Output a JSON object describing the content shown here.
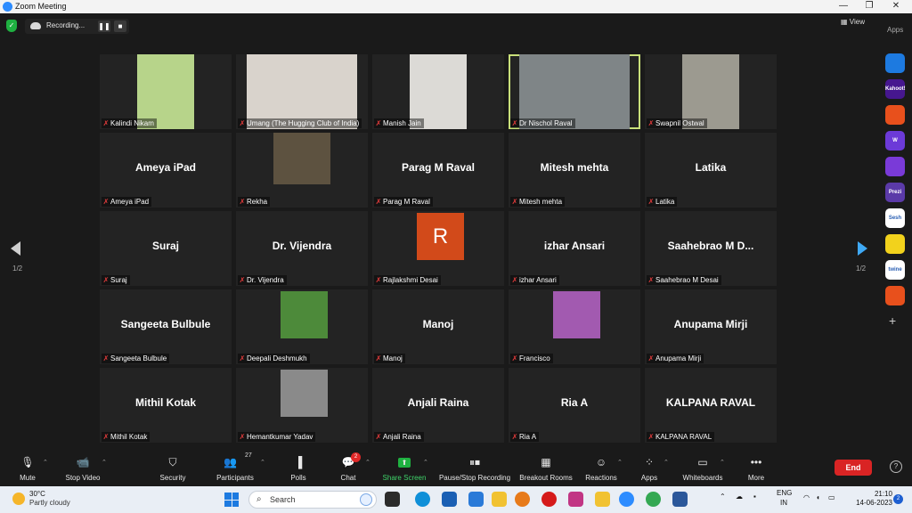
{
  "window": {
    "title": "Zoom Meeting",
    "minimize": "—",
    "restore": "❐",
    "close": "✕"
  },
  "top": {
    "recording_text": "Recording...",
    "pause_icon": "❚❚",
    "stop_icon": "■",
    "view_label": "View",
    "apps_label": "Apps"
  },
  "pagination": {
    "left": "1/2",
    "right": "1/2"
  },
  "participants": [
    {
      "label": "Kalindi Nikam",
      "display": "",
      "kind": "video",
      "video_color": "#b7d48a"
    },
    {
      "label": "Umang (The Hugging Club of India)",
      "display": "",
      "kind": "video",
      "video_color": "#d9d3cc"
    },
    {
      "label": "Manish Jain",
      "display": "",
      "kind": "video",
      "video_color": "#dcdad6"
    },
    {
      "label": "Dr Nischol Raval",
      "display": "",
      "kind": "video",
      "video_color": "#7f8587"
    },
    {
      "label": "Swapnil Ostwal",
      "display": "",
      "kind": "video",
      "video_color": "#9c9a90"
    },
    {
      "label": "Ameya iPad",
      "display": "Ameya iPad",
      "kind": "name"
    },
    {
      "label": "Rekha",
      "display": "",
      "kind": "video",
      "video_color": "#5d5240"
    },
    {
      "label": "Parag M Raval",
      "display": "Parag M Raval",
      "kind": "name"
    },
    {
      "label": "Mitesh mehta",
      "display": "Mitesh mehta",
      "kind": "name"
    },
    {
      "label": "Latika",
      "display": "Latika",
      "kind": "name"
    },
    {
      "label": "Suraj",
      "display": "Suraj",
      "kind": "name"
    },
    {
      "label": "Dr. Vijendra",
      "display": "Dr. Vijendra",
      "kind": "name"
    },
    {
      "label": "Rajlakshmi Desai",
      "display": "R",
      "kind": "initial",
      "avatar_color": "#d24a1a"
    },
    {
      "label": "izhar Ansari",
      "display": "izhar Ansari",
      "kind": "name"
    },
    {
      "label": "Saahebrao M Desai",
      "display": "Saahebrao M D...",
      "kind": "name"
    },
    {
      "label": "Sangeeta Bulbule",
      "display": "Sangeeta Bulbule",
      "kind": "name"
    },
    {
      "label": "Deepali Deshmukh",
      "display": "",
      "kind": "photo",
      "avatar_color": "#4d8a3a"
    },
    {
      "label": "Manoj",
      "display": "Manoj",
      "kind": "name"
    },
    {
      "label": "Francisco",
      "display": "",
      "kind": "photo",
      "avatar_color": "#a25ab0"
    },
    {
      "label": "Anupama Mirji",
      "display": "Anupama Mirji",
      "kind": "name"
    },
    {
      "label": "Mithil Kotak",
      "display": "Mithil Kotak",
      "kind": "name"
    },
    {
      "label": "Hemantkumar Yadav",
      "display": "",
      "kind": "photo",
      "avatar_color": "#8a8a8a"
    },
    {
      "label": "Anjali Raina",
      "display": "Anjali Raina",
      "kind": "name"
    },
    {
      "label": "Ria A",
      "display": "Ria A",
      "kind": "name"
    },
    {
      "label": "KALPANA RAVAL",
      "display": "KALPANA RAVAL",
      "kind": "name"
    }
  ],
  "app_rail": [
    {
      "name": "app-1",
      "text": "",
      "color": "#1d7ae0"
    },
    {
      "name": "kahoot",
      "text": "Kahoot!",
      "color": "#46178f"
    },
    {
      "name": "app-3",
      "text": "",
      "color": "#e8501c"
    },
    {
      "name": "wooclap",
      "text": "W",
      "color": "#6c3ad8"
    },
    {
      "name": "app-5",
      "text": "",
      "color": "#7a3ad8"
    },
    {
      "name": "prezi",
      "text": "Prezi",
      "color": "#5b3aa8"
    },
    {
      "name": "sesh",
      "text": "Sesh",
      "color": "#ffffff"
    },
    {
      "name": "app-8",
      "text": "",
      "color": "#f2d21c"
    },
    {
      "name": "twine",
      "text": "twine",
      "color": "#ffffff"
    },
    {
      "name": "app-10",
      "text": "",
      "color": "#e8501c"
    }
  ],
  "toolbar": {
    "mute": "Mute",
    "stop_video": "Stop Video",
    "security": "Security",
    "participants": "Participants",
    "participants_count": "27",
    "polls": "Polls",
    "chat": "Chat",
    "chat_badge": "2",
    "share_screen": "Share Screen",
    "pause_recording": "Pause/Stop Recording",
    "breakout_rooms": "Breakout Rooms",
    "reactions": "Reactions",
    "apps": "Apps",
    "whiteboards": "Whiteboards",
    "more": "More",
    "end": "End",
    "help": "?"
  },
  "taskbar": {
    "temp": "30°C",
    "weather": "Partly cloudy",
    "search": "Search",
    "lang_top": "ENG",
    "lang_bottom": "IN",
    "time": "21:10",
    "date": "14-06-2023",
    "notifications": "2"
  }
}
